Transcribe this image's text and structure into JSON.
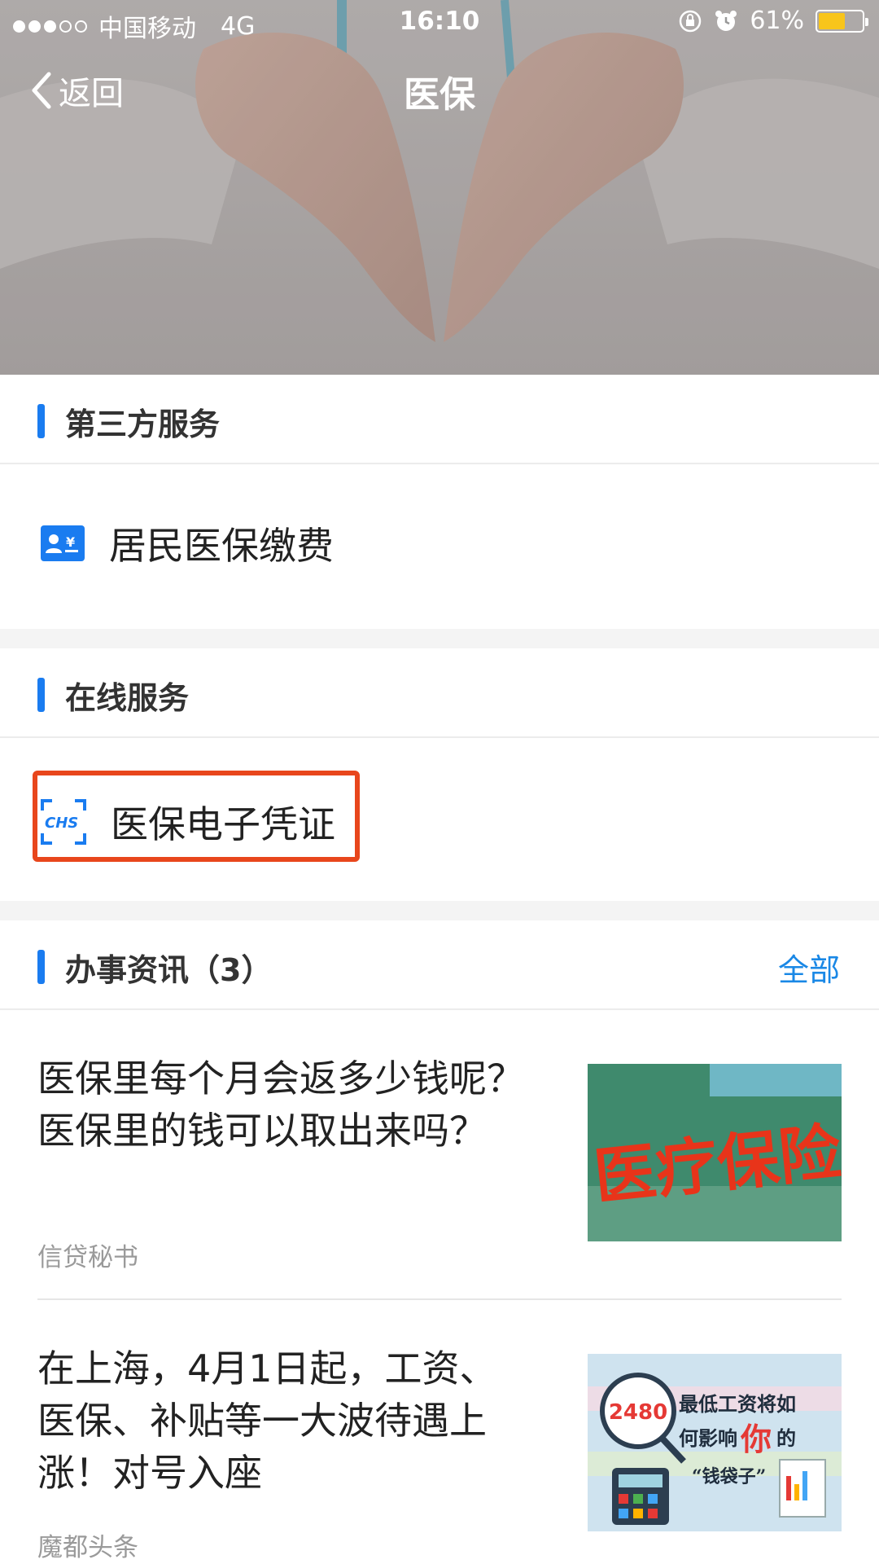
{
  "status_bar": {
    "carrier": "中国移动",
    "network": "4G",
    "time": "16:10",
    "battery_percent": "61%",
    "battery_level": 0.61,
    "battery_color": "#f8c51b"
  },
  "nav": {
    "back_label": "返回",
    "title": "医保"
  },
  "sections": {
    "third_party": {
      "title": "第三方服务",
      "items": [
        {
          "label": "居民医保缴费",
          "icon": "id-card-icon"
        }
      ]
    },
    "online": {
      "title": "在线服务",
      "items": [
        {
          "label": "医保电子凭证",
          "icon": "chs-scan-icon"
        }
      ]
    },
    "news": {
      "title": "办事资讯（3）",
      "more_label": "全部",
      "items": [
        {
          "headline": "医保里每个月会返多少钱呢？医保里的钱可以取出来吗？",
          "source": "信贷秘书",
          "thumb_text": "医疗保险"
        },
        {
          "headline": "在上海，4月1日起，工资、医保、补贴等一大波待遇上涨！对号入座",
          "source": "魔都头条",
          "thumb_text": [
            "2480",
            "最低工资将如",
            "何影响",
            "你",
            "的",
            "“钱袋子”"
          ]
        }
      ]
    }
  },
  "colors": {
    "accent": "#1a7cf0",
    "link": "#1a88e6",
    "highlight": "#e8461c"
  }
}
